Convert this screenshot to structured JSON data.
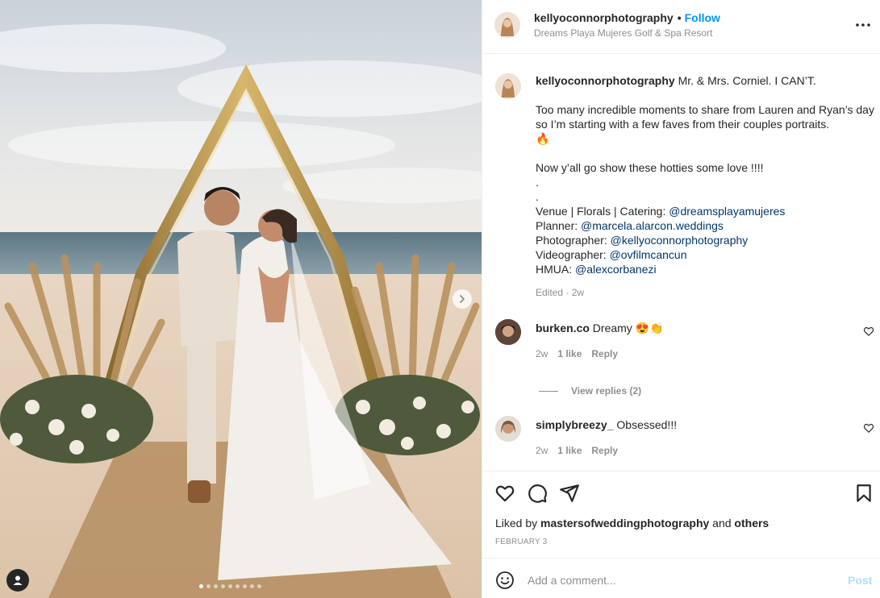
{
  "post": {
    "carousel_total": 9,
    "carousel_current": 1
  },
  "header": {
    "username": "kellyoconnorphotography",
    "separator": "•",
    "follow_label": "Follow",
    "location": "Dreams Playa Mujeres Golf & Spa Resort",
    "more_icon": "more-horizontal-icon"
  },
  "caption": {
    "username": "kellyoconnorphotography",
    "first_line": "Mr. & Mrs. Corniel. I CAN’T.",
    "para2": "Too many incredible moments to share from Lauren and Ryan’s day so I’m starting with a few faves from their couples portraits.",
    "para2_emoji": "🔥",
    "para3": "Now y’all go show these hotties some love !!!!",
    "dot1": ".",
    "dot2": ".",
    "credits": [
      {
        "label": "Venue | Florals | Catering: ",
        "handle": "@dreamsplayamujeres"
      },
      {
        "label": "Planner: ",
        "handle": "@marcela.alarcon.weddings"
      },
      {
        "label": "Photographer: ",
        "handle": "@kellyoconnorphotography"
      },
      {
        "label": "Videographer: ",
        "handle": "@ovfilmcancun"
      },
      {
        "label": "HMUA: ",
        "handle": "@alexcorbanezi"
      }
    ],
    "meta": "Edited · 2w"
  },
  "comments": [
    {
      "username": "burken.co",
      "text": "Dreamy 😍👏",
      "age": "2w",
      "likes": "1 like",
      "reply_label": "Reply"
    },
    {
      "username": "simplybreezy_",
      "text": "Obsessed!!!",
      "age": "2w",
      "likes": "1 like",
      "reply_label": "Reply"
    }
  ],
  "view_replies": "View replies (2)",
  "actions": {
    "liked_prefix": "Liked by ",
    "liked_user": "mastersofweddingphotography",
    "liked_and": " and ",
    "liked_others": "others",
    "date": "FEBRUARY 3"
  },
  "add_comment": {
    "placeholder": "Add a comment...",
    "post_label": "Post"
  },
  "colors": {
    "accent": "#0095f6",
    "mention": "#00376b",
    "muted": "#8e8e8e",
    "post_disabled": "#b2dffc"
  }
}
